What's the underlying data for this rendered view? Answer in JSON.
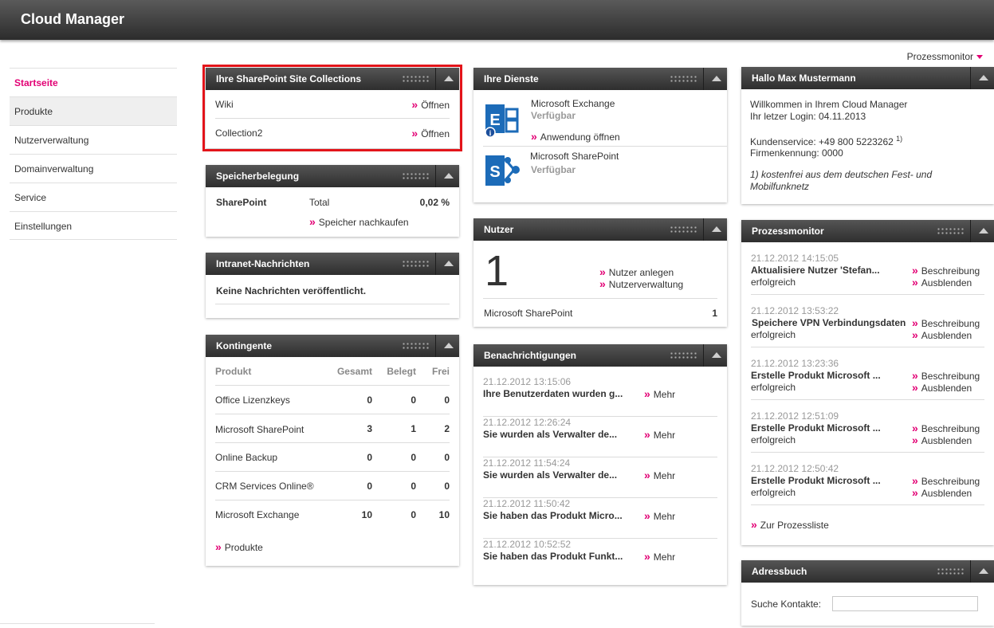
{
  "app": {
    "title": "Cloud Manager"
  },
  "top_link": {
    "label": "Prozessmonitor"
  },
  "nav": [
    {
      "label": "Startseite"
    },
    {
      "label": "Produkte"
    },
    {
      "label": "Nutzerverwaltung"
    },
    {
      "label": "Domainverwaltung"
    },
    {
      "label": "Service"
    },
    {
      "label": "Einstellungen"
    }
  ],
  "sharepoint_sites": {
    "title": "Ihre SharePoint Site Collections",
    "items": [
      {
        "name": "Wiki",
        "action": "Öffnen"
      },
      {
        "name": "Collection2",
        "action": "Öffnen"
      }
    ]
  },
  "storage": {
    "title": "Speicherbelegung",
    "product": "SharePoint",
    "label": "Total",
    "value": "0,02 %",
    "link": "Speicher nachkaufen"
  },
  "intranet": {
    "title": "Intranet-Nachrichten",
    "message": "Keine Nachrichten veröffentlicht."
  },
  "quotas": {
    "title": "Kontingente",
    "headers": [
      "Produkt",
      "Gesamt",
      "Belegt",
      "Frei"
    ],
    "rows": [
      [
        "Office Lizenzkeys",
        "0",
        "0",
        "0"
      ],
      [
        "Microsoft SharePoint",
        "3",
        "1",
        "2"
      ],
      [
        "Online Backup",
        "0",
        "0",
        "0"
      ],
      [
        "CRM Services Online®",
        "0",
        "0",
        "0"
      ],
      [
        "Microsoft Exchange",
        "10",
        "0",
        "10"
      ]
    ],
    "link": "Produkte"
  },
  "services": {
    "title": "Ihre Dienste",
    "items": [
      {
        "name": "Microsoft Exchange",
        "status": "Verfügbar",
        "link": "Anwendung öffnen"
      },
      {
        "name": "Microsoft SharePoint",
        "status": "Verfügbar"
      }
    ]
  },
  "users": {
    "title": "Nutzer",
    "count": "1",
    "links": [
      "Nutzer anlegen",
      "Nutzerverwaltung"
    ],
    "service": "Microsoft SharePoint",
    "service_count": "1"
  },
  "notifications": {
    "title": "Benachrichtigungen",
    "more_label": "Mehr",
    "items": [
      {
        "time": "21.12.2012 13:15:06",
        "text": "Ihre Benutzerdaten wurden g..."
      },
      {
        "time": "21.12.2012 12:26:24",
        "text": "Sie wurden als Verwalter de..."
      },
      {
        "time": "21.12.2012 11:54:24",
        "text": "Sie wurden als Verwalter de..."
      },
      {
        "time": "21.12.2012 11:50:42",
        "text": "Sie haben das Produkt Micro..."
      },
      {
        "time": "21.12.2012 10:52:52",
        "text": "Sie haben das Produkt Funkt..."
      }
    ]
  },
  "welcome": {
    "title": "Hallo Max Mustermann",
    "line1": "Willkommen in Ihrem Cloud Manager",
    "line2": "Ihr letzer Login: 04.11.2013",
    "service_label": "Kundenservice: +49 800 5223262",
    "service_sup": "1)",
    "company": "Firmenkennung: 0000",
    "note_line1": "1) kostenfrei aus dem deutschen Fest- und",
    "note_line2": "Mobilfunknetz"
  },
  "process_monitor": {
    "title": "Prozessmonitor",
    "desc_label": "Beschreibung",
    "hide_label": "Ausblenden",
    "items": [
      {
        "time": "21.12.2012 14:15:05",
        "text": "Aktualisiere Nutzer 'Stefan...",
        "status": "erfolgreich"
      },
      {
        "time": "21.12.2012 13:53:22",
        "text": "Speichere VPN Verbindungsdaten",
        "status": "erfolgreich"
      },
      {
        "time": "21.12.2012 13:23:36",
        "text": "Erstelle Produkt Microsoft ...",
        "status": "erfolgreich"
      },
      {
        "time": "21.12.2012 12:51:09",
        "text": "Erstelle Produkt Microsoft ...",
        "status": "erfolgreich"
      },
      {
        "time": "21.12.2012 12:50:42",
        "text": "Erstelle Produkt Microsoft ...",
        "status": "erfolgreich"
      }
    ],
    "footer_link": "Zur Prozessliste"
  },
  "addressbook": {
    "title": "Adressbuch",
    "search_label": "Suche Kontakte:",
    "search_value": ""
  }
}
